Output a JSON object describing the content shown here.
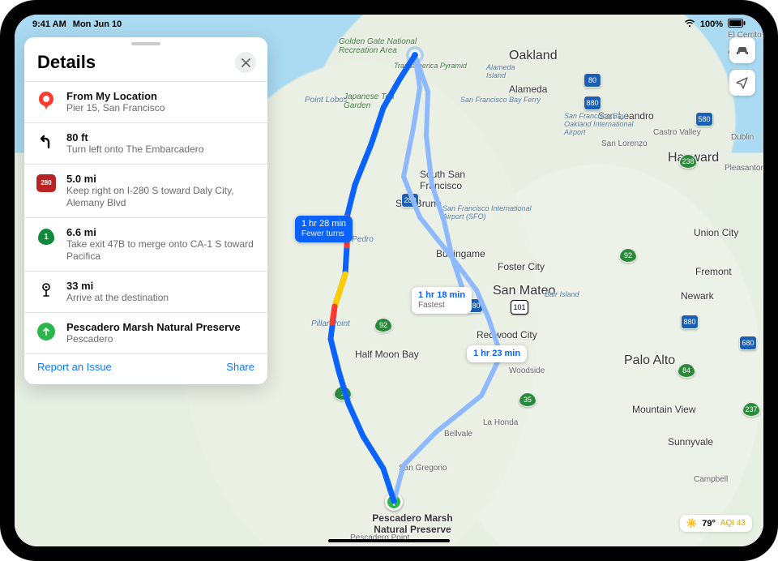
{
  "status": {
    "time": "9:41 AM",
    "date": "Mon Jun 10",
    "battery": "100%"
  },
  "panel": {
    "title": "Details",
    "steps": [
      {
        "icon": "start-pin",
        "title": "From My Location",
        "sub": "Pier 15, San Francisco"
      },
      {
        "icon": "turn-left",
        "title": "80 ft",
        "sub": "Turn left onto The Embarcadero"
      },
      {
        "icon": "i280",
        "title": "5.0 mi",
        "sub": "Keep right on I-280 S toward Daly City, Alemany Blvd"
      },
      {
        "icon": "ca1",
        "title": "6.6 mi",
        "sub": "Take exit 47B to merge onto CA-1 S toward Pacifica"
      },
      {
        "icon": "arrive",
        "title": "33 mi",
        "sub": "Arrive at the destination"
      },
      {
        "icon": "end-pin",
        "title": "Pescadero Marsh Natural Preserve",
        "sub": "Pescadero"
      }
    ],
    "report": "Report an Issue",
    "share": "Share"
  },
  "route_callouts": {
    "primary": {
      "time": "1 hr 28 min",
      "note": "Fewer turns"
    },
    "alt1": {
      "time": "1 hr 18 min",
      "note": "Fastest"
    },
    "alt2": {
      "time": "1 hr 23 min",
      "note": ""
    }
  },
  "destination_label": "Pescadero Marsh Natural Preserve",
  "map_labels": {
    "oakland": "Oakland",
    "hayward": "Hayward",
    "sanmateo": "San Mateo",
    "paloalto": "Palo Alto",
    "sunnyvale": "Sunnyvale",
    "mountainview": "Mountain View",
    "redwoodcity": "Redwood City",
    "fostercity": "Foster City",
    "sanbruno": "San Bruno",
    "southsf": "South San Francisco",
    "burlingame": "Burlingame",
    "alameda": "Alameda",
    "sanleandro": "San Leandro",
    "fremont": "Fremont",
    "newark": "Newark",
    "unioncity": "Union City",
    "dublin": "Dublin",
    "pleasanton": "Pleasanton",
    "castrovalley": "Castro Valley",
    "sanlorenzo": "San Lorenzo",
    "campbell": "Campbell",
    "elcerrito": "El Cerrito",
    "albany": "Albany",
    "woodside": "Woodside",
    "lahonda": "La Honda",
    "bellvale": "Bellvale",
    "sangregorio": "San Gregorio",
    "pescaderopt": "Pescadero Point",
    "pillarpt": "Pillar Point",
    "sanpedro": "Point San Pedro",
    "pointlobos": "Point Lobos",
    "ggnra": "Golden Gate National Recreation Area",
    "teagarden": "Japanese Tea Garden",
    "transamerica": "Transamerica Pyramid",
    "alamedais": "Alameda Island",
    "bairisland": "Bair Island",
    "hmb": "Half Moon Bay",
    "sfoname": "San Francisco International Airport (SFO)",
    "oakname": "San Francisco Bay Oakland International Airport",
    "ferry": "San Francisco Bay Ferry"
  },
  "shields": {
    "i280a": "280",
    "i280b": "280",
    "i80": "80",
    "i880a": "880",
    "i880b": "880",
    "i580": "580",
    "us101": "101",
    "ca92": "92",
    "ca92b": "92",
    "ca1": "1",
    "ca35": "35",
    "ca84": "84",
    "ca237": "237",
    "ca238": "238",
    "i680": "680"
  },
  "weather": {
    "temp": "79°",
    "aqi": "AQI 43"
  }
}
